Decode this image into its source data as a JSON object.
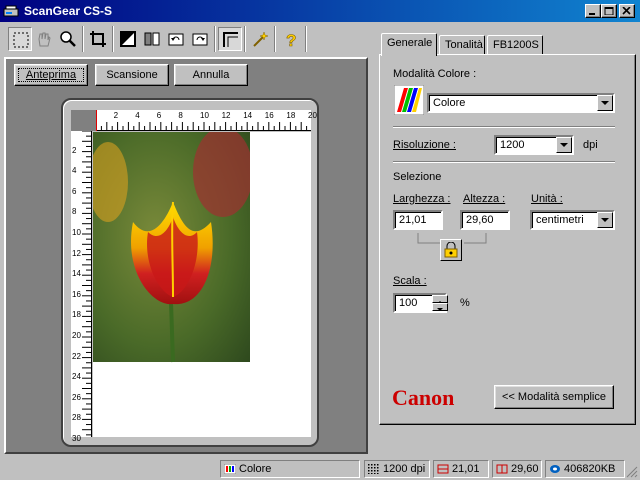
{
  "window": {
    "title": "ScanGear CS-S"
  },
  "toolbar": {
    "icons": [
      "select-icon",
      "hand-icon",
      "zoom-icon",
      "crop-icon",
      "exposure-icon",
      "mirror-icon",
      "rotate-left-icon",
      "rotate-right-icon",
      "frame-icon",
      "auto-icon",
      "help-icon"
    ]
  },
  "preview": {
    "buttons": {
      "preview": "Anteprima",
      "scan": "Scansione",
      "cancel": "Annulla"
    },
    "ruler_h": [
      "2",
      "4",
      "6",
      "8",
      "10",
      "12",
      "14",
      "16",
      "18",
      "20"
    ],
    "ruler_v": [
      "2",
      "4",
      "6",
      "8",
      "10",
      "12",
      "14",
      "16",
      "18",
      "20",
      "22",
      "24",
      "26",
      "28",
      "30"
    ]
  },
  "tabs": [
    "Generale",
    "Tonalità",
    "FB1200S"
  ],
  "general": {
    "color_mode_label": "Modalità Colore :",
    "color_mode_value": "Colore",
    "resolution_label": "Risoluzione :",
    "resolution_value": "1200",
    "resolution_unit": "dpi",
    "selection_label": "Selezione",
    "width_label": "Larghezza :",
    "height_label": "Altezza :",
    "unit_label": "Unità :",
    "width_value": "21,01",
    "height_value": "29,60",
    "unit_value": "centimetri",
    "scale_label": "Scala :",
    "scale_value": "100",
    "scale_unit": "%",
    "brand": "Canon",
    "simple_mode_button": "<< Modalità semplice"
  },
  "status": {
    "mode": "Colore",
    "resolution": "1200 dpi",
    "width": "21,01",
    "height": "29,60",
    "size": "406820KB"
  },
  "colors": {
    "titlebar": "#000080",
    "brand": "#cc0000"
  }
}
